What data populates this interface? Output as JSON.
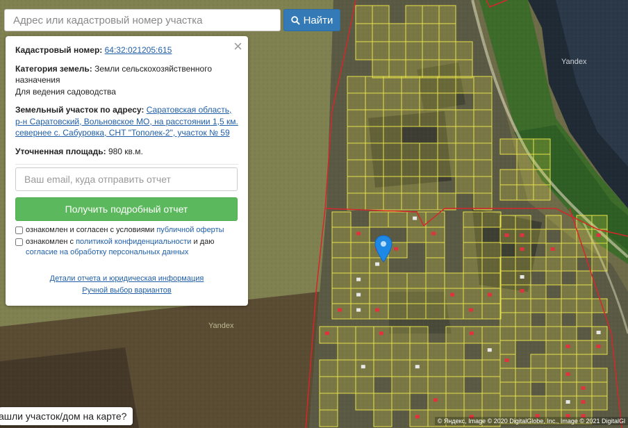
{
  "search": {
    "placeholder": "Адрес или кадастровый номер участка",
    "button_label": "Найти"
  },
  "card": {
    "cadastral_label": "Кадастровый номер:",
    "cadastral_value": "64:32:021205:615",
    "category_label": "Категория земель:",
    "category_value": "Земли сельскохозяйственного назначения",
    "usage": "Для ведения садоводства",
    "address_label": "Земельный участок по адресу:",
    "address_value": "Саратовская область, р-н Саратовский, Вольновское МО, на расстоянии 1,5 км. севернее с. Сабуровка, СНТ \"Тополек-2\", участок № 59",
    "area_label": "Уточненная площадь:",
    "area_value": "980 кв.м.",
    "email_placeholder": "Ваш email, куда отправить отчет",
    "report_button": "Получить подробный отчет",
    "consent1_text": "ознакомлен и согласен с условиями",
    "consent1_link": "публичной оферты",
    "consent2_text": "ознакомлен с",
    "consent2_link": "политикой конфиденциальности",
    "consent2_and": "и даю",
    "consent2_link2": "согласие на обработку персональных данных",
    "details_link": "Детали отчета и юридическая информация",
    "manual_link": "Ручной выбор вариантов"
  },
  "map": {
    "watermark1": "Yandex",
    "watermark2": "Yandex",
    "bottom_tip": "ашли участок/дом на карте?",
    "copyright": "© Яндекс, Image © 2020 DigitalGlobe, Inc., Image © 2021 DigitalGl"
  },
  "colors": {
    "parcel_outline": "#e8e24a",
    "boundary": "#d6262b",
    "pin": "#1e88e5",
    "search_button": "#337ab7",
    "report_button": "#5cb85c"
  },
  "icons": {
    "search_button": "search-icon",
    "close": "close-icon",
    "pin": "map-pin-icon"
  }
}
